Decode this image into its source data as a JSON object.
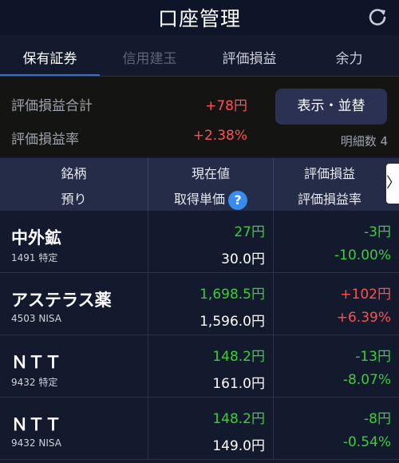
{
  "header": {
    "title": "口座管理",
    "refresh_icon": "refresh-icon"
  },
  "tabs": [
    {
      "label": "保有証券",
      "state": "active"
    },
    {
      "label": "信用建玉",
      "state": "disabled"
    },
    {
      "label": "評価損益",
      "state": "normal"
    },
    {
      "label": "余力",
      "state": "normal"
    }
  ],
  "summary": {
    "total_pl_label": "評価損益合計",
    "total_pl_value": "+78円",
    "pl_rate_label": "評価損益率",
    "pl_rate_value": "+2.38%",
    "display_button": "表示・並替",
    "detail_count": "明細数 4"
  },
  "table_header": {
    "col1_line1": "銘柄",
    "col1_line2": "預り",
    "col2_line1": "現在値",
    "col2_line2": "取得単価",
    "col3_line1": "評価損益",
    "col3_line2": "評価損益率",
    "help_icon": "?",
    "scroll_arrow": "〉"
  },
  "rows": [
    {
      "name": "中外鉱",
      "code": "1491 特定",
      "price": "27円",
      "cost": "30.0円",
      "pl": "-3円",
      "pl_rate": "-10.00%",
      "sign": "neg"
    },
    {
      "name": "アステラス薬",
      "code": "4503 NISA",
      "price": "1,698.5円",
      "cost": "1,596.0円",
      "pl": "+102円",
      "pl_rate": "+6.39%",
      "sign": "pos"
    },
    {
      "name": "ＮＴＴ",
      "code": "9432 特定",
      "price": "148.2円",
      "cost": "161.0円",
      "pl": "-13円",
      "pl_rate": "-8.07%",
      "sign": "neg"
    },
    {
      "name": "ＮＴＴ",
      "code": "9432 NISA",
      "price": "148.2円",
      "cost": "149.0円",
      "pl": "-8円",
      "pl_rate": "-0.54%",
      "sign": "neg"
    }
  ],
  "colors": {
    "background": "#131a2e",
    "accent": "#2f6fe0",
    "positive": "#ff5050",
    "negative": "#3ecb3e"
  }
}
